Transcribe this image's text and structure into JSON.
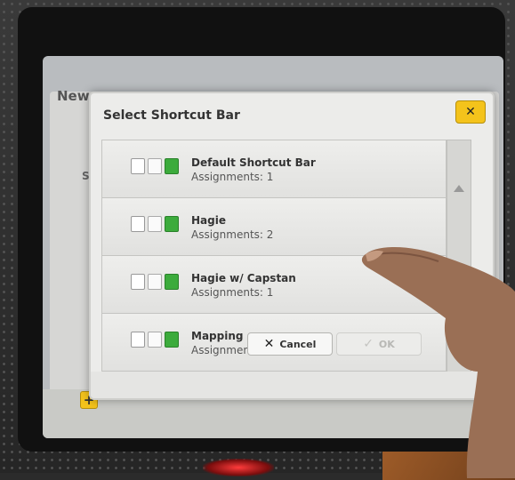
{
  "background_window": {
    "title": "New",
    "item_letters": "St"
  },
  "dialog": {
    "title": "Select Shortcut Bar",
    "close_icon": "close-x-icon",
    "items": [
      {
        "name": "Default Shortcut Bar",
        "assignments": "Assignments: 1"
      },
      {
        "name": "Hagie",
        "assignments": "Assignments: 2"
      },
      {
        "name": "Hagie w/ Capstan",
        "assignments": "Assignments: 1"
      },
      {
        "name": "Mapping",
        "assignments": "Assignments: 1"
      }
    ],
    "cancel_label": "Cancel",
    "ok_label": "OK"
  },
  "add_label": "+",
  "colors": {
    "accent_yellow": "#f4c31b",
    "icon_green": "#3cab3c"
  }
}
